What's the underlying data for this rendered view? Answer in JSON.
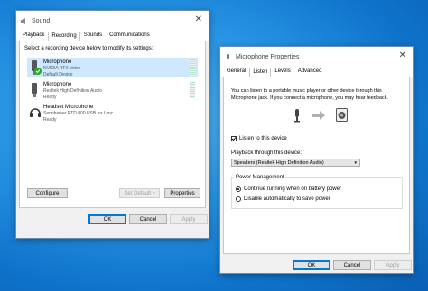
{
  "sound_window": {
    "title": "Sound",
    "tabs": [
      "Playback",
      "Recording",
      "Sounds",
      "Communications"
    ],
    "active_tab": "Recording",
    "instruction": "Select a recording device below to modify its settings:",
    "devices": [
      {
        "name": "Microphone",
        "driver": "NVIDIA RTX Voice",
        "status": "Default Device",
        "icon": "microphone-default-icon"
      },
      {
        "name": "Microphone",
        "driver": "Realtek High Definition Audio",
        "status": "Ready",
        "icon": "microphone-icon"
      },
      {
        "name": "Headset Microphone",
        "driver": "Sennheiser RTD 800 USB for Lync",
        "status": "Ready",
        "icon": "headset-icon"
      }
    ],
    "buttons": {
      "configure": "Configure",
      "set_default": "Set Default",
      "properties": "Properties",
      "ok": "OK",
      "cancel": "Cancel",
      "apply": "Apply"
    }
  },
  "props_window": {
    "title": "Microphone Properties",
    "tabs": [
      "General",
      "Listen",
      "Levels",
      "Advanced"
    ],
    "active_tab": "Listen",
    "description": "You can listen to a portable music player or other device through this Microphone jack.  If you connect a microphone, you may hear feedback.",
    "listen_checkbox": {
      "label": "Listen to this device",
      "checked": true
    },
    "playback_label": "Playback through this device:",
    "playback_value": "Speakers (Realtek High Definition Audio)",
    "power_group": "Power Management",
    "power_options": [
      "Continue running when on battery power",
      "Disable automatically to save power"
    ],
    "power_selected": 0,
    "buttons": {
      "ok": "OK",
      "cancel": "Cancel",
      "apply": "Apply"
    }
  },
  "colors": {
    "accent": "#0078d7",
    "selection": "#cde8ff",
    "desktop": "#1a82d9"
  }
}
